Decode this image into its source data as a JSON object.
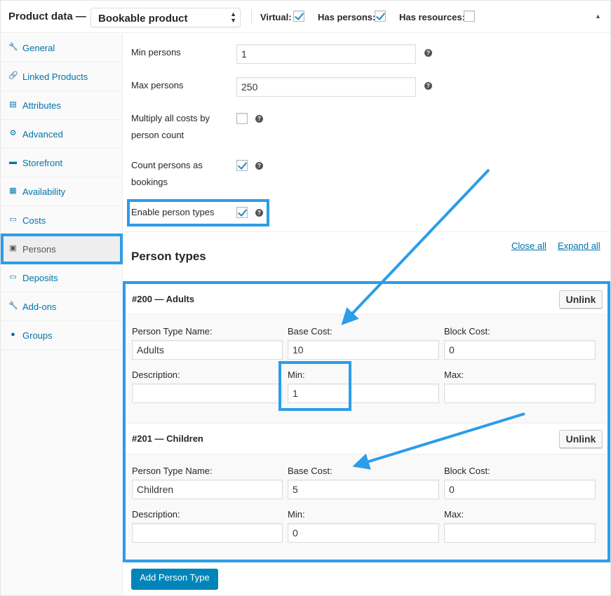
{
  "header": {
    "title": "Product data —",
    "product_type": "Bookable product",
    "virtual_label": "Virtual:",
    "virtual": true,
    "has_persons_label": "Has persons:",
    "has_persons": true,
    "has_resources_label": "Has resources:",
    "has_resources": false
  },
  "sidebar": {
    "items": [
      {
        "label": "General",
        "icon": "wrench-icon",
        "glyph": "🔧"
      },
      {
        "label": "Linked Products",
        "icon": "link-icon",
        "glyph": "🔗"
      },
      {
        "label": "Attributes",
        "icon": "list-card-icon",
        "glyph": "▤"
      },
      {
        "label": "Advanced",
        "icon": "gear-icon",
        "glyph": "⚙"
      },
      {
        "label": "Storefront",
        "icon": "store-icon",
        "glyph": "▬"
      },
      {
        "label": "Availability",
        "icon": "calendar-icon",
        "glyph": "▦"
      },
      {
        "label": "Costs",
        "icon": "card-icon",
        "glyph": "▭"
      },
      {
        "label": "Persons",
        "icon": "person-icon",
        "glyph": "▣"
      },
      {
        "label": "Deposits",
        "icon": "card-icon",
        "glyph": "▭"
      },
      {
        "label": "Add-ons",
        "icon": "wrench-icon",
        "glyph": "🔧"
      },
      {
        "label": "Groups",
        "icon": "groups-icon",
        "glyph": "●"
      }
    ],
    "active": "Persons"
  },
  "fields": {
    "min_persons_label": "Min persons",
    "min_persons": "1",
    "max_persons_label": "Max persons",
    "max_persons": "250",
    "multiply_label_1": "Multiply all costs by",
    "multiply_label_2": "person count",
    "multiply": false,
    "count_label_1": "Count persons as",
    "count_label_2": "bookings",
    "count": true,
    "enable_types_label": "Enable person types",
    "enable_types": true
  },
  "person_types": {
    "heading": "Person types",
    "close_all": "Close all",
    "expand_all": "Expand all",
    "labels": {
      "name": "Person Type Name:",
      "base_cost": "Base Cost:",
      "block_cost": "Block Cost:",
      "description": "Description:",
      "min": "Min:",
      "max": "Max:"
    },
    "unlink": "Unlink",
    "items": [
      {
        "title": "#200 — Adults",
        "name": "Adults",
        "base_cost": "10",
        "block_cost": "0",
        "description": "",
        "min": "1",
        "max": ""
      },
      {
        "title": "#201 — Children",
        "name": "Children",
        "base_cost": "5",
        "block_cost": "0",
        "description": "",
        "min": "0",
        "max": ""
      }
    ],
    "add_button": "Add Person Type"
  },
  "colors": {
    "highlight": "#2b9de9",
    "link": "#0073aa",
    "primary": "#0085ba"
  }
}
